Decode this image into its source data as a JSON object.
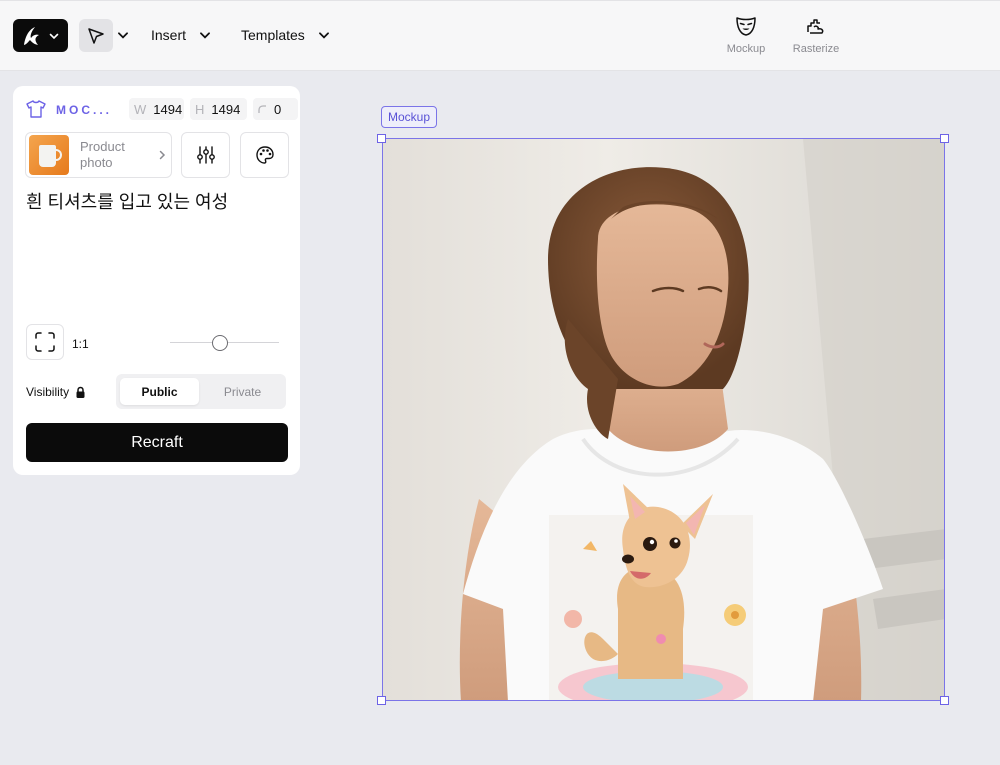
{
  "toolbar": {
    "insert_label": "Insert",
    "templates_label": "Templates",
    "mockup_label": "Mockup",
    "rasterize_label": "Rasterize"
  },
  "panel": {
    "type_label": "MOC...",
    "width_key": "W",
    "width_value": "1494",
    "height_key": "H",
    "height_value": "1494",
    "rotation_value": "0",
    "product_label": "Product photo",
    "prompt": "흰 티셔츠를 입고 있는 여성",
    "ratio_label": "1:1",
    "slider_value": 0.46,
    "visibility_label": "Visibility",
    "public_label": "Public",
    "private_label": "Private",
    "submit_label": "Recraft"
  },
  "canvas": {
    "frame_label": "Mockup"
  },
  "colors": {
    "accent": "#6d63e6",
    "primary_button": "#0b0b0b",
    "background": "#e9eaef"
  },
  "icons": [
    "recraft-logo-icon",
    "chevron-down-icon",
    "pointer-icon",
    "mask-icon",
    "rasterize-icon",
    "shirt-icon",
    "rotation-icon",
    "mug-thumbnail",
    "chevron-right-icon",
    "sliders-icon",
    "palette-icon",
    "aspect-ratio-icon",
    "lock-icon"
  ]
}
